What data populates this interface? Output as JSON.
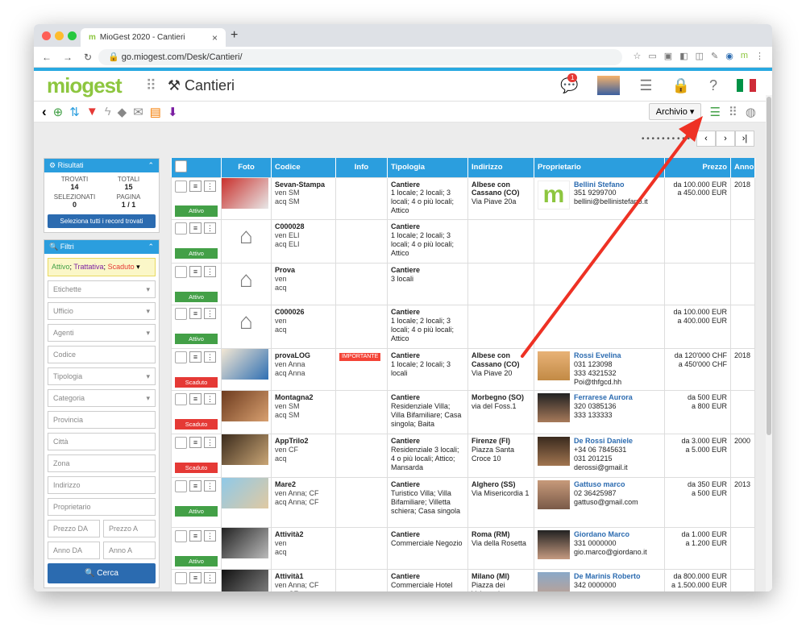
{
  "browser": {
    "tab_title": "MioGest 2020 - Cantieri",
    "url": "go.miogest.com/Desk/Cantieri/"
  },
  "app": {
    "logo": "miogest",
    "page_title": "Cantieri",
    "notif_count": "1"
  },
  "toolbar": {
    "archive_label": "Archivio"
  },
  "pager": {
    "dots": "• • • • • • • • • •"
  },
  "results": {
    "title": "Risultati",
    "found_label": "TROVATI",
    "found": "14",
    "total_label": "TOTALI",
    "total": "15",
    "selected_label": "SELEZIONATI",
    "selected": "0",
    "page_label": "PAGINA",
    "page": "1 / 1",
    "select_all": "Seleziona tutti i record trovati"
  },
  "filters": {
    "title": "Filtri",
    "status_active": "Attivo",
    "status_sep": "; ",
    "status_trattativa": "Trattativa",
    "status_scaduto": "Scaduto",
    "etichette": "Etichette",
    "ufficio": "Ufficio",
    "agenti": "Agenti",
    "codice": "Codice",
    "tipologia": "Tipologia",
    "categoria": "Categoria",
    "provincia": "Provincia",
    "citta": "Città",
    "zona": "Zona",
    "indirizzo": "Indirizzo",
    "proprietario": "Proprietario",
    "prezzo_da": "Prezzo DA",
    "prezzo_a": "Prezzo A",
    "anno_da": "Anno DA",
    "anno_a": "Anno A",
    "search": "Cerca"
  },
  "table": {
    "headers": [
      "",
      "Foto",
      "Codice",
      "Info",
      "Tipologia",
      "Indirizzo",
      "Proprietario",
      "Prezzo",
      "Anno"
    ]
  },
  "rows": [
    {
      "status": "Attivo",
      "photo": "img",
      "code": "Sevan-Stampa",
      "ven": "ven SM",
      "acq": "acq SM",
      "info": "",
      "tip1": "Cantiere",
      "tip2": "1 locale; 2 locali; 3 locali; 4 o più locali; Attico",
      "ind1": "Albese con Cassano (CO)",
      "ind2": "Via Piave 20a",
      "owner": "Bellini Stefano",
      "o1": "351 9299700",
      "o2": "bellini@bellinistefano.it",
      "o3": "",
      "p1": "da 100.000 EUR",
      "p2": "a 450.000 EUR",
      "year": "2018"
    },
    {
      "status": "Attivo",
      "photo": "house",
      "code": "C000028",
      "ven": "ven ELI",
      "acq": "acq ELI",
      "info": "",
      "tip1": "Cantiere",
      "tip2": "1 locale; 2 locali; 3 locali; 4 o più locali; Attico",
      "ind1": "",
      "ind2": "",
      "owner": "",
      "o1": "",
      "o2": "",
      "o3": "",
      "p1": "",
      "p2": "",
      "year": ""
    },
    {
      "status": "Attivo",
      "photo": "house",
      "code": "Prova",
      "ven": "ven",
      "acq": "acq",
      "info": "",
      "tip1": "Cantiere",
      "tip2": "3 locali",
      "ind1": "",
      "ind2": "",
      "owner": "",
      "o1": "",
      "o2": "",
      "o3": "",
      "p1": "",
      "p2": "",
      "year": ""
    },
    {
      "status": "Attivo",
      "photo": "house",
      "code": "C000026",
      "ven": "ven",
      "acq": "acq",
      "info": "",
      "tip1": "Cantiere",
      "tip2": "1 locale; 2 locali; 3 locali; 4 o più locali; Attico",
      "ind1": "",
      "ind2": "",
      "owner": "",
      "o1": "",
      "o2": "",
      "o3": "",
      "p1": "da 100.000 EUR",
      "p2": "a 400.000 EUR",
      "year": ""
    },
    {
      "status": "Scaduto",
      "photo": "img",
      "code": "provaLOG",
      "ven": "ven Anna",
      "acq": "acq Anna",
      "info": "IMPORTANTE",
      "tip1": "Cantiere",
      "tip2": "1 locale; 2 locali; 3 locali",
      "ind1": "Albese con Cassano (CO)",
      "ind2": "Via Piave 20",
      "owner": "Rossi Evelina",
      "o1": "031 123098",
      "o2": "333 4321532",
      "o3": "Poi@thfgcd.hh",
      "p1": "da 120'000 CHF",
      "p2": "a 450'000 CHF",
      "year": "2018"
    },
    {
      "status": "Scaduto",
      "photo": "img",
      "code": "Montagna2",
      "ven": "ven SM",
      "acq": "acq SM",
      "info": "",
      "tip1": "Cantiere",
      "tip2": "Residenziale Villa; Villa Bifamiliare; Casa singola; Baita",
      "ind1": "Morbegno (SO)",
      "ind2": "via del Foss.1",
      "owner": "Ferrarese Aurora",
      "o1": "320 0385136",
      "o2": "333 133333",
      "o3": "",
      "p1": "da 500 EUR",
      "p2": "a 800 EUR",
      "year": ""
    },
    {
      "status": "Scaduto",
      "photo": "img",
      "code": "AppTrilo2",
      "ven": "ven CF",
      "acq": "acq",
      "info": "",
      "tip1": "Cantiere",
      "tip2": "Residenziale 3 locali; 4 o più locali; Attico; Mansarda",
      "ind1": "Firenze (FI)",
      "ind2": "Piazza Santa Croce 10",
      "owner": "De Rossi Daniele",
      "o1": "+34 06 7845631",
      "o2": "031 201215",
      "o3": "derossi@gmail.it",
      "p1": "da 3.000 EUR",
      "p2": "a 5.000 EUR",
      "year": "2000"
    },
    {
      "status": "Attivo",
      "photo": "img",
      "code": "Mare2",
      "ven": "ven Anna; CF",
      "acq": "acq Anna; CF",
      "info": "",
      "tip1": "Cantiere",
      "tip2": "Turistico Villa; Villa Bifamiliare; Villetta schiera; Casa singola",
      "ind1": "Alghero (SS)",
      "ind2": "Via Misericordia 1",
      "owner": "Gattuso marco",
      "o1": "02 36425987",
      "o2": "gattuso@gmail.com",
      "o3": "",
      "p1": "da 350 EUR",
      "p2": "a 500 EUR",
      "year": "2013"
    },
    {
      "status": "Attivo",
      "photo": "img",
      "code": "Attività2",
      "ven": "ven",
      "acq": "acq",
      "info": "",
      "tip1": "Cantiere",
      "tip2": "Commerciale Negozio",
      "ind1": "Roma (RM)",
      "ind2": "Via della Rosetta",
      "owner": "Giordano Marco",
      "o1": "331 0000000",
      "o2": "gio.marco@giordano.it",
      "o3": "",
      "p1": "da 1.000 EUR",
      "p2": "a 1.200 EUR",
      "year": ""
    },
    {
      "status": "",
      "photo": "img",
      "code": "Attività1",
      "ven": "ven Anna; CF",
      "acq": "acq CF",
      "info": "",
      "tip1": "Cantiere",
      "tip2": "Commerciale Hotel",
      "ind1": "Milano (MI)",
      "ind2": "Piazza dei Volontari",
      "owner": "De Marinis Roberto",
      "o1": "342 0000000",
      "o2": "",
      "o3": "",
      "p1": "da 800.000 EUR",
      "p2": "a 1.500.000 EUR",
      "year": ""
    }
  ]
}
